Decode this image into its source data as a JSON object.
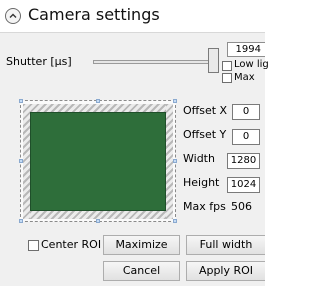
{
  "header": {
    "title": "Camera settings"
  },
  "shutter": {
    "label": "Shutter [µs]",
    "value": "1994",
    "low_light_label": "Low lig",
    "max_label": "Max"
  },
  "fields": {
    "offset_x": {
      "label": "Offset X",
      "value": "0"
    },
    "offset_y": {
      "label": "Offset Y",
      "value": "0"
    },
    "width": {
      "label": "Width",
      "value": "1280"
    },
    "height": {
      "label": "Height",
      "value": "1024"
    },
    "max_fps": {
      "label": "Max fps",
      "value": "506"
    }
  },
  "buttons": {
    "center_roi": "Center ROI",
    "maximize": "Maximize",
    "full_width": "Full width",
    "cancel": "Cancel",
    "apply_roi": "Apply ROI"
  },
  "colors": {
    "roi_fill": "#2e6e3a",
    "panel_bg": "#f0f0f0"
  },
  "icons": {
    "collapse": "chevron-up-icon"
  }
}
